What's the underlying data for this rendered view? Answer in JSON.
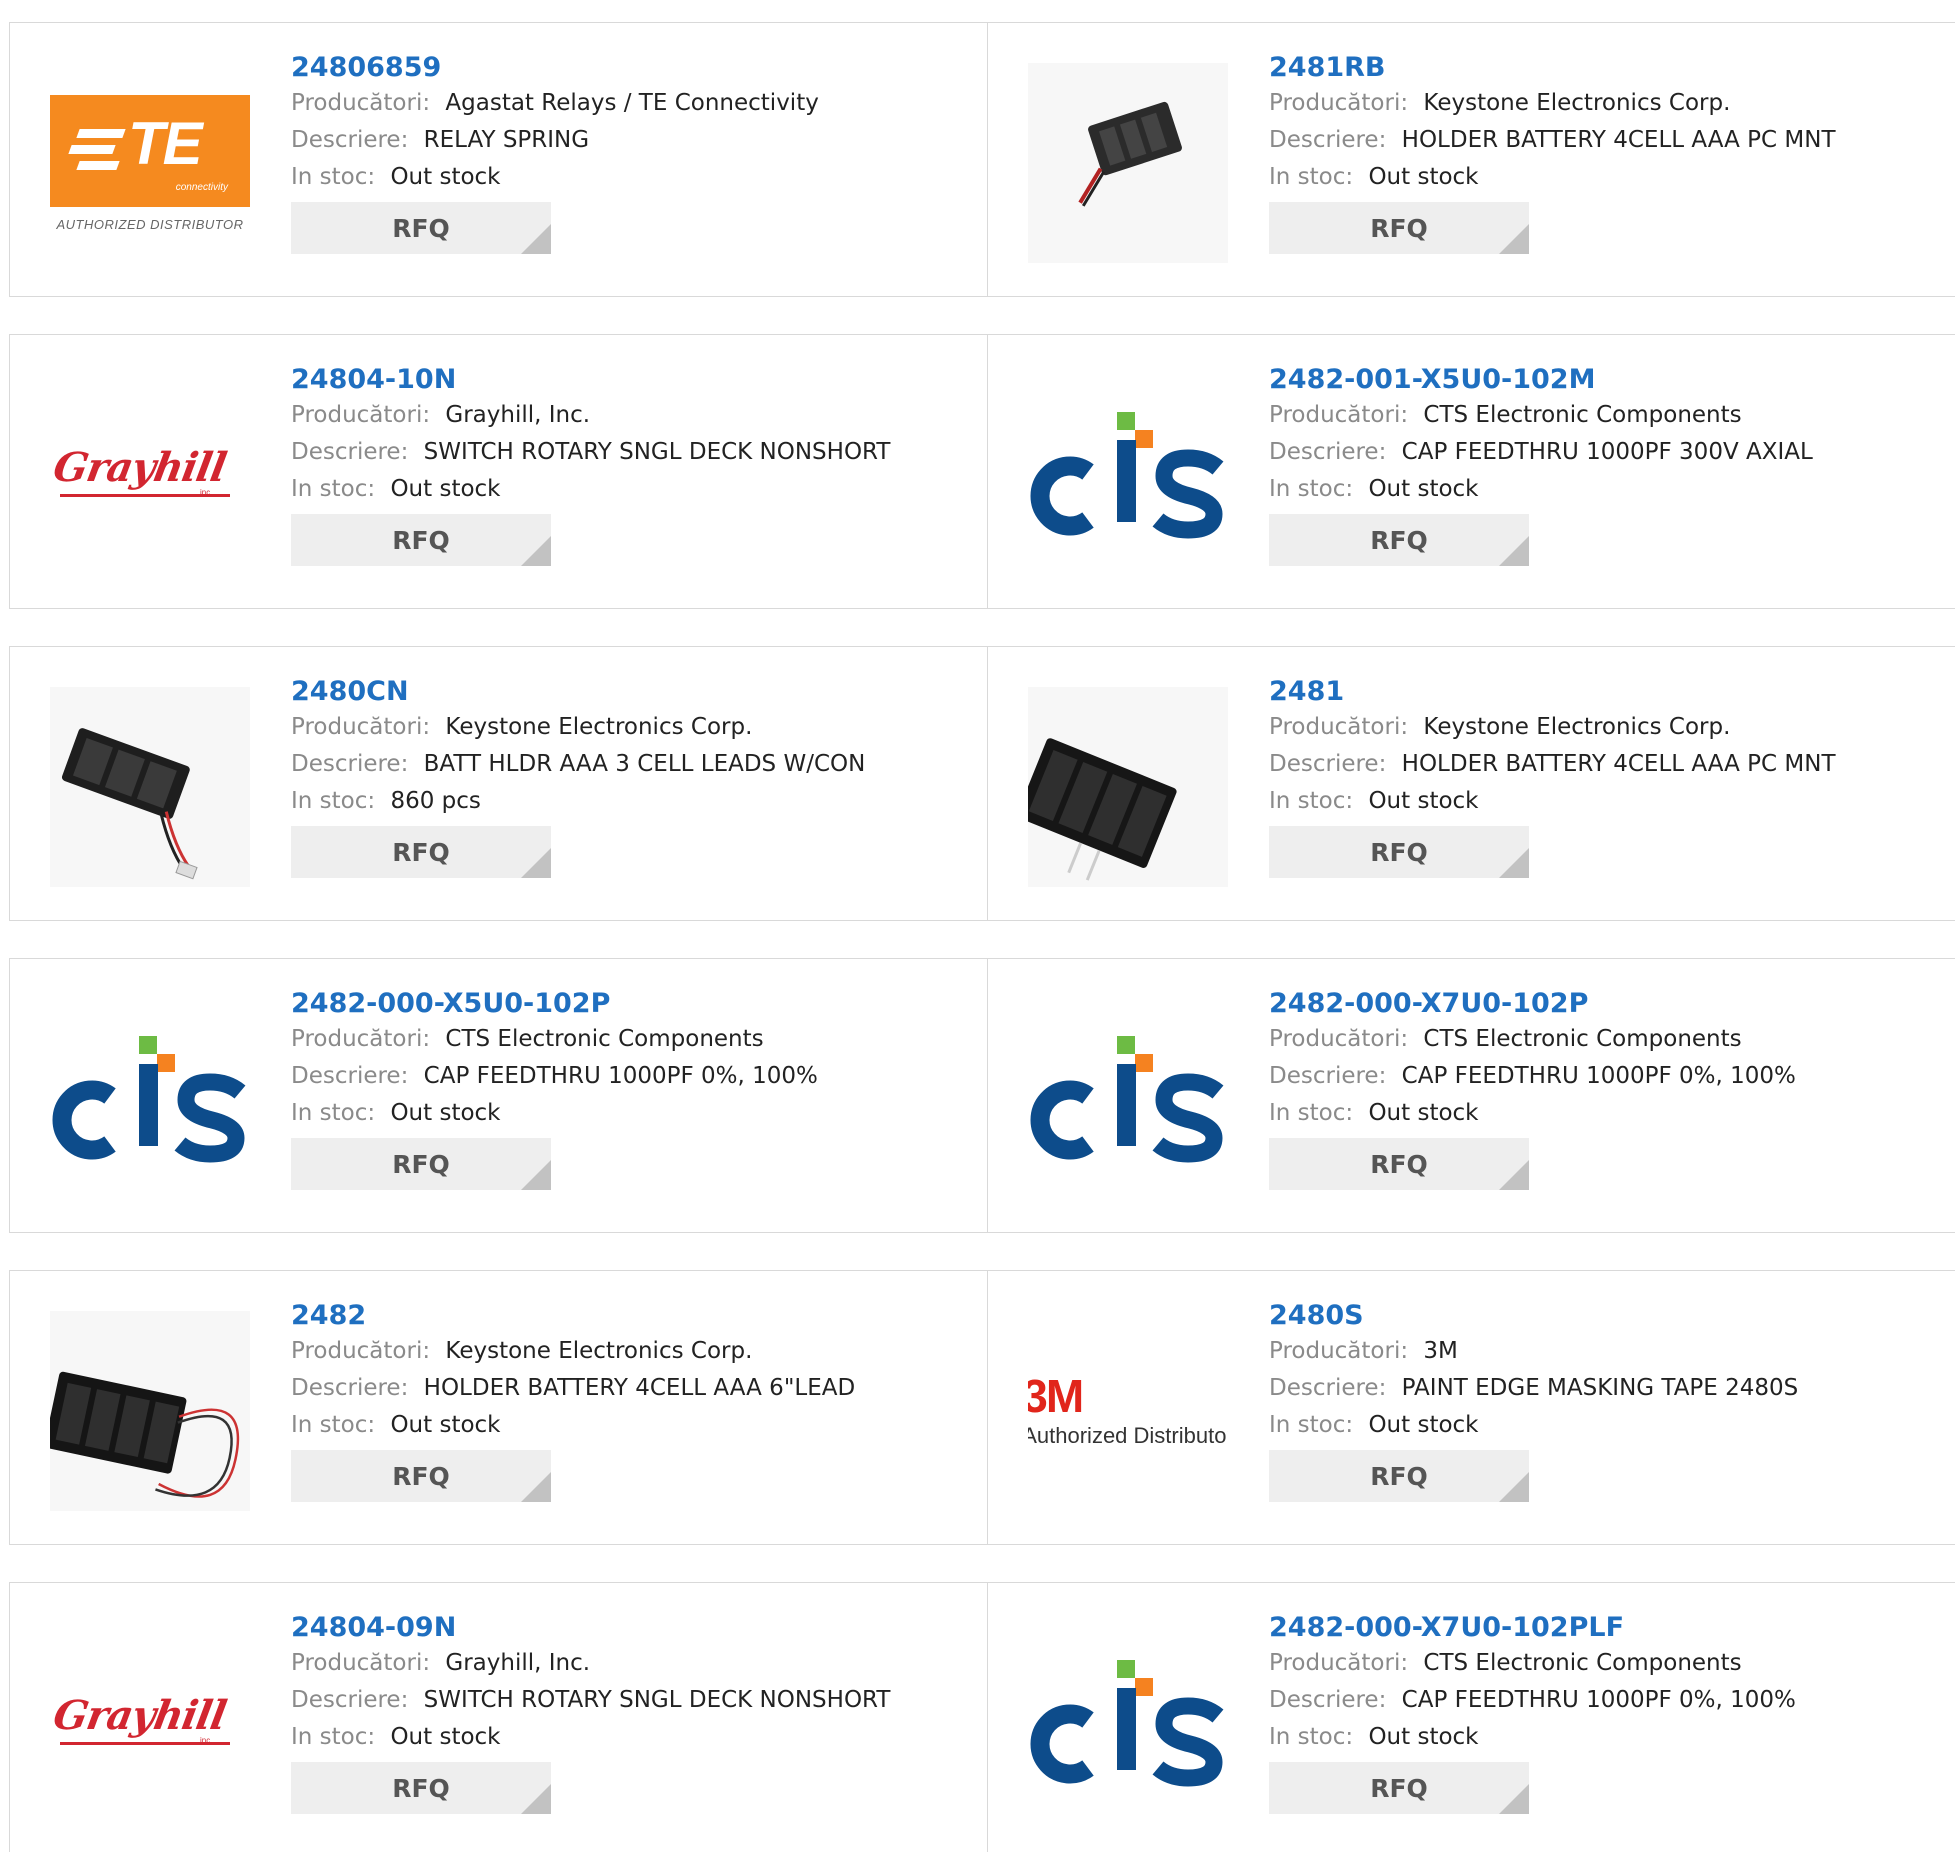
{
  "labels": {
    "manufacturer": "Producători:",
    "description": "Descriere:",
    "stock": "In stoc:",
    "rfq": "RFQ"
  },
  "colors": {
    "part_link": "#1f6fc0",
    "te_orange": "#f58a1f",
    "cts_blue": "#0d4c8b",
    "cts_green": "#6dbb44",
    "cts_orange": "#f58220",
    "grayhill_red": "#d22630",
    "mmm_red": "#e1251b"
  },
  "products": [
    {
      "part": "24806859",
      "manufacturer": "Agastat Relays / TE Connectivity",
      "description": "RELAY SPRING",
      "stock": "Out stock",
      "logo": "te-connectivity-logo",
      "logo_text": {
        "mark": "TE",
        "sub": "connectivity",
        "caption": "AUTHORIZED DISTRIBUTOR"
      }
    },
    {
      "part": "2481RB",
      "manufacturer": "Keystone Electronics Corp.",
      "description": "HOLDER BATTERY 4CELL AAA PC MNT",
      "stock": "Out stock",
      "logo": "battery-holder-photo"
    },
    {
      "part": "24804-10N",
      "manufacturer": "Grayhill, Inc.",
      "description": "SWITCH ROTARY SNGL DECK NONSHORT",
      "stock": "Out stock",
      "logo": "grayhill-logo",
      "logo_text": {
        "mark": "Grayhill",
        "sub": "inc."
      }
    },
    {
      "part": "2482-001-X5U0-102M",
      "manufacturer": "CTS Electronic Components",
      "description": "CAP FEEDTHRU 1000PF 300V AXIAL",
      "stock": "Out stock",
      "logo": "cts-logo"
    },
    {
      "part": "2480CN",
      "manufacturer": "Keystone Electronics Corp.",
      "description": "BATT HLDR AAA 3 CELL LEADS W/CON",
      "stock": "860 pcs",
      "logo": "battery-holder-photo"
    },
    {
      "part": "2481",
      "manufacturer": "Keystone Electronics Corp.",
      "description": "HOLDER BATTERY 4CELL AAA PC MNT",
      "stock": "Out stock",
      "logo": "battery-holder-photo"
    },
    {
      "part": "2482-000-X5U0-102P",
      "manufacturer": "CTS Electronic Components",
      "description": "CAP FEEDTHRU 1000PF 0%, 100%",
      "stock": "Out stock",
      "logo": "cts-logo"
    },
    {
      "part": "2482-000-X7U0-102P",
      "manufacturer": "CTS Electronic Components",
      "description": "CAP FEEDTHRU 1000PF 0%, 100%",
      "stock": "Out stock",
      "logo": "cts-logo"
    },
    {
      "part": "2482",
      "manufacturer": "Keystone Electronics Corp.",
      "description": "HOLDER BATTERY 4CELL AAA 6\"LEAD",
      "stock": "Out stock",
      "logo": "battery-holder-photo"
    },
    {
      "part": "2480S",
      "manufacturer": "3M",
      "description": "PAINT EDGE MASKING TAPE 2480S",
      "stock": "Out stock",
      "logo": "3m-logo",
      "logo_text": {
        "mark": "3M",
        "caption": "Authorized Distributor"
      }
    },
    {
      "part": "24804-09N",
      "manufacturer": "Grayhill, Inc.",
      "description": "SWITCH ROTARY SNGL DECK NONSHORT",
      "stock": "Out stock",
      "logo": "grayhill-logo",
      "logo_text": {
        "mark": "Grayhill",
        "sub": "inc."
      }
    },
    {
      "part": "2482-000-X7U0-102PLF",
      "manufacturer": "CTS Electronic Components",
      "description": "CAP FEEDTHRU 1000PF 0%, 100%",
      "stock": "Out stock",
      "logo": "cts-logo"
    }
  ]
}
